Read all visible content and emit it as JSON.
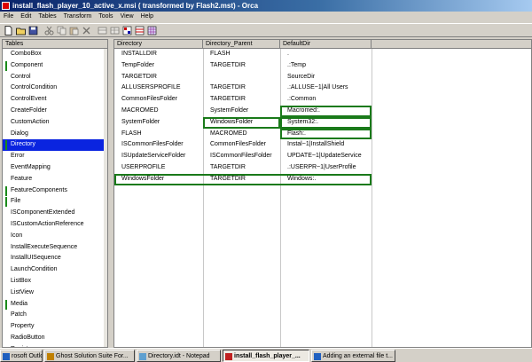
{
  "window": {
    "title": "install_flash_player_10_active_x.msi ( transformed by Flash2.mst) - Orca"
  },
  "menu": [
    "File",
    "Edit",
    "Tables",
    "Transform",
    "Tools",
    "View",
    "Help"
  ],
  "toolbar": {
    "icons": [
      "new-file-icon",
      "open-folder-icon",
      "save-icon",
      "cut-icon",
      "copy-icon",
      "paste-icon",
      "delete-icon",
      "add-row-icon",
      "drop-row-icon",
      "validate-icon",
      "transform-icon",
      "table-grid-icon"
    ]
  },
  "tables": {
    "header": "Tables",
    "items": [
      {
        "label": "ComboBox",
        "mark": false
      },
      {
        "label": "Component",
        "mark": true
      },
      {
        "label": "Control",
        "mark": false
      },
      {
        "label": "ControlCondition",
        "mark": false
      },
      {
        "label": "ControlEvent",
        "mark": false
      },
      {
        "label": "CreateFolder",
        "mark": false
      },
      {
        "label": "CustomAction",
        "mark": false
      },
      {
        "label": "Dialog",
        "mark": false
      },
      {
        "label": "Directory",
        "mark": true,
        "selected": true
      },
      {
        "label": "Error",
        "mark": false
      },
      {
        "label": "EventMapping",
        "mark": false
      },
      {
        "label": "Feature",
        "mark": false
      },
      {
        "label": "FeatureComponents",
        "mark": true
      },
      {
        "label": "File",
        "mark": true
      },
      {
        "label": "ISComponentExtended",
        "mark": false
      },
      {
        "label": "ISCustomActionReference",
        "mark": false
      },
      {
        "label": "Icon",
        "mark": false
      },
      {
        "label": "InstallExecuteSequence",
        "mark": false
      },
      {
        "label": "InstallUISequence",
        "mark": false
      },
      {
        "label": "LaunchCondition",
        "mark": false
      },
      {
        "label": "ListBox",
        "mark": false
      },
      {
        "label": "ListView",
        "mark": false
      },
      {
        "label": "Media",
        "mark": true
      },
      {
        "label": "Patch",
        "mark": false
      },
      {
        "label": "Property",
        "mark": false
      },
      {
        "label": "RadioButton",
        "mark": false
      },
      {
        "label": "Registry",
        "mark": false
      }
    ]
  },
  "grid": {
    "columns": [
      "Directory",
      "Directory_Parent",
      "DefaultDir"
    ],
    "rows": [
      {
        "cells": [
          "INSTALLDIR",
          "FLASH",
          "."
        ],
        "hl": [
          false,
          false,
          false
        ]
      },
      {
        "cells": [
          "TempFolder",
          "TARGETDIR",
          ".:Temp"
        ],
        "hl": [
          false,
          false,
          false
        ]
      },
      {
        "cells": [
          "TARGETDIR",
          "",
          "SourceDir"
        ],
        "hl": [
          false,
          false,
          false
        ]
      },
      {
        "cells": [
          "ALLUSERSPROFILE",
          "TARGETDIR",
          ".:ALLUSE~1|All Users"
        ],
        "hl": [
          false,
          false,
          false
        ]
      },
      {
        "cells": [
          "CommonFilesFolder",
          "TARGETDIR",
          ".:Common"
        ],
        "hl": [
          false,
          false,
          false
        ]
      },
      {
        "cells": [
          "MACROMED",
          "SystemFolder",
          "Macromed:."
        ],
        "hl": [
          false,
          false,
          true
        ]
      },
      {
        "cells": [
          "SystemFolder",
          "WindowsFolder",
          "System32:."
        ],
        "hl": [
          false,
          true,
          true
        ]
      },
      {
        "cells": [
          "FLASH",
          "MACROMED",
          "Flash:."
        ],
        "hl": [
          false,
          false,
          true
        ]
      },
      {
        "cells": [
          "ISCommonFilesFolder",
          "CommonFilesFolder",
          "Instal~1|InstallShield"
        ],
        "hl": [
          false,
          false,
          false
        ]
      },
      {
        "cells": [
          "ISUpdateServiceFolder",
          "ISCommonFilesFolder",
          "UPDATE~1|UpdateService"
        ],
        "hl": [
          false,
          false,
          false
        ]
      },
      {
        "cells": [
          "USERPROFILE",
          "TARGETDIR",
          ".:USERPR~1|UserProfile"
        ],
        "hl": [
          false,
          false,
          false
        ]
      },
      {
        "cells": [
          "WindowsFolder",
          "TARGETDIR",
          "Windows:."
        ],
        "hl": [
          false,
          false,
          false
        ],
        "rowhl": true
      }
    ]
  },
  "taskbar": {
    "items": [
      {
        "label": "rosoft Outlook",
        "icon": "outlook-icon",
        "active": false
      },
      {
        "label": "Ghost Solution Suite For...",
        "icon": "ghost-icon",
        "active": false
      },
      {
        "label": "Directory.idt - Notepad",
        "icon": "notepad-icon",
        "active": false
      },
      {
        "label": "install_flash_player_...",
        "icon": "orca-icon",
        "active": true
      },
      {
        "label": "Adding an external file t...",
        "icon": "browser-icon",
        "active": false
      }
    ]
  }
}
